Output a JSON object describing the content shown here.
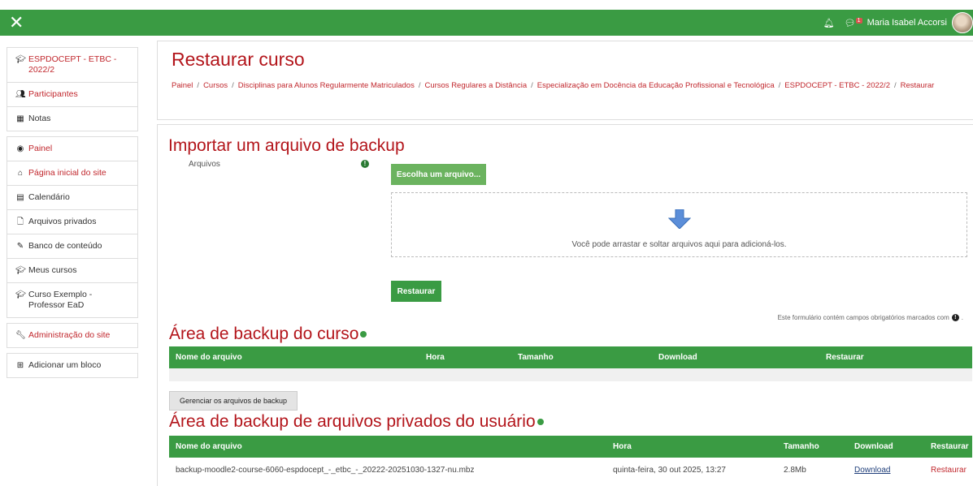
{
  "navbar": {
    "close_icon": "close-icon",
    "user_name": "Maria Isabel Accorsi",
    "message_badge": "1",
    "notification_icon": "bell-icon",
    "message_icon": "chat-icon",
    "color": "#3a9b43"
  },
  "sidebar": {
    "block1": [
      {
        "label": "ESPDOCEPT - ETBC - 2022/2",
        "icon": "graduation-cap-icon",
        "red": true
      },
      {
        "label": "Participantes",
        "icon": "users-icon",
        "red": true
      },
      {
        "label": "Notas",
        "icon": "table-icon",
        "red": false
      }
    ],
    "block2": [
      {
        "label": "Painel",
        "icon": "dashboard-icon",
        "red": true
      },
      {
        "label": "Página inicial do site",
        "icon": "home-icon",
        "red": true
      },
      {
        "label": "Calendário",
        "icon": "calendar-icon",
        "red": false
      },
      {
        "label": "Arquivos privados",
        "icon": "file-icon",
        "red": false
      },
      {
        "label": "Banco de conteúdo",
        "icon": "brush-icon",
        "red": false
      },
      {
        "label": "Meus cursos",
        "icon": "graduation-cap-icon",
        "red": false
      },
      {
        "label": "Curso Exemplo - Professor EaD",
        "icon": "graduation-cap-icon",
        "red": false
      }
    ],
    "block3": [
      {
        "label": "Administração do site",
        "icon": "wrench-icon",
        "red": true
      }
    ],
    "block4": [
      {
        "label": "Adicionar um bloco",
        "icon": "plus-square-icon",
        "red": false
      }
    ]
  },
  "header": {
    "title": "Restaurar curso",
    "breadcrumb": [
      "Painel",
      "Cursos",
      "Disciplinas para Alunos Regularmente Matriculados",
      "Cursos Regulares a Distância",
      "Especialização em Docência da Educação Profissional e Tecnológica",
      "ESPDOCEPT - ETBC - 2022/2",
      "Restaurar"
    ]
  },
  "import": {
    "heading": "Importar um arquivo de backup",
    "files_label": "Arquivos",
    "choose_button": "Escolha um arquivo...",
    "drop_text": "Você pode arrastar e soltar arquivos aqui para adicioná-los.",
    "restore_button": "Restaurar",
    "required_note": "Este formulário contém campos obrigatórios marcados com"
  },
  "course_backup": {
    "heading": "Área de backup do curso",
    "columns": [
      "Nome do arquivo",
      "Hora",
      "Tamanho",
      "Download",
      "Restaurar"
    ],
    "manage_button": "Gerenciar os arquivos de backup"
  },
  "user_backup": {
    "heading": "Área de backup de arquivos privados do usuário",
    "columns": [
      "Nome do arquivo",
      "Hora",
      "Tamanho",
      "Download",
      "Restaurar"
    ],
    "rows": [
      {
        "file": "backup-moodle2-course-6060-espdocept_-_etbc_-_20222-20251030-1327-nu.mbz",
        "time": "quinta-feira, 30 out 2025, 13:27",
        "size": "2.8Mb",
        "download": "Download",
        "restore": "Restaurar"
      }
    ]
  }
}
